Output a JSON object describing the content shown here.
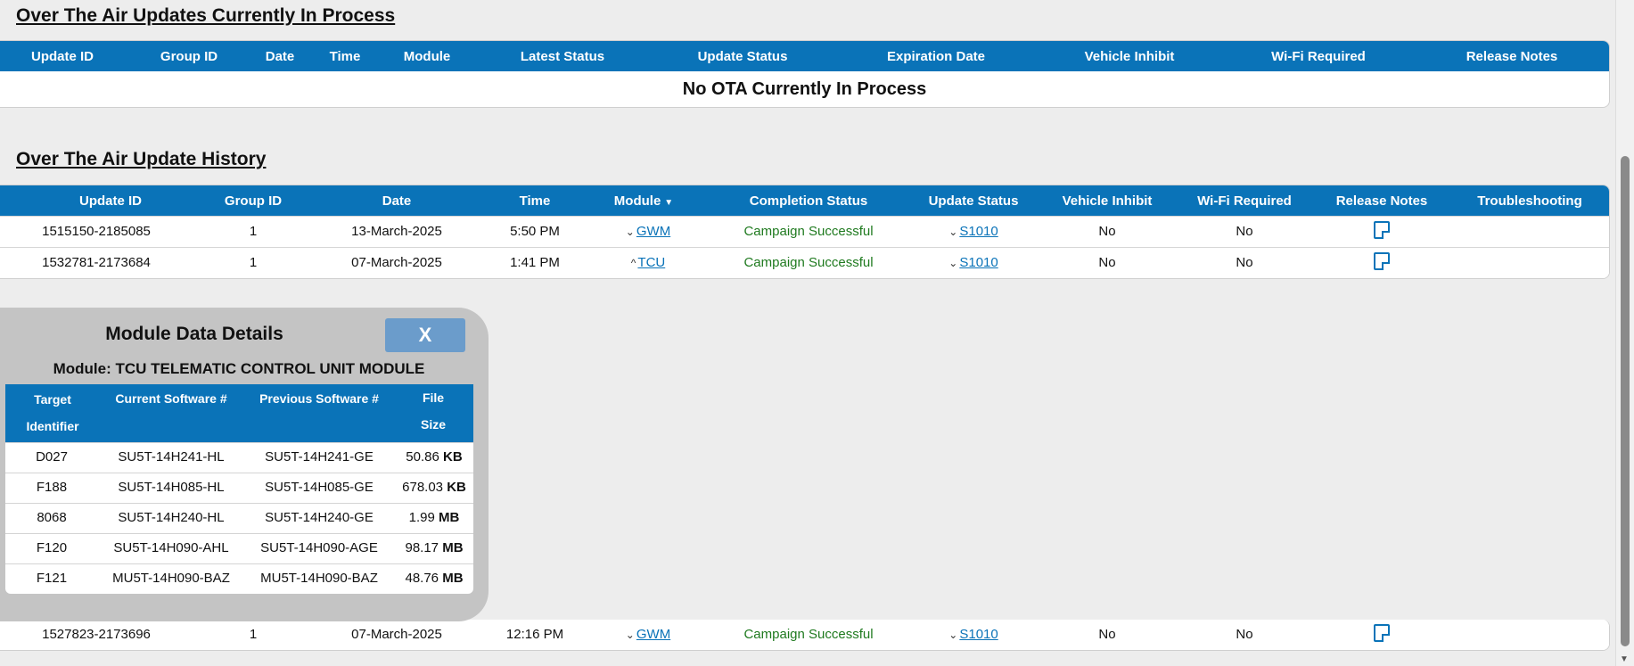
{
  "in_process": {
    "title": "Over The Air Updates Currently In Process",
    "headers": [
      "Update ID",
      "Group ID",
      "Date",
      "Time",
      "Module",
      "Latest Status",
      "Update Status",
      "Expiration Date",
      "Vehicle Inhibit",
      "Wi-Fi Required",
      "Release Notes"
    ],
    "empty_message": "No OTA Currently In Process"
  },
  "history": {
    "title": "Over The Air Update History",
    "headers": [
      "Update ID",
      "Group ID",
      "Date",
      "Time",
      "Module",
      "Completion Status",
      "Update Status",
      "Vehicle Inhibit",
      "Wi-Fi Required",
      "Release Notes",
      "Troubleshooting"
    ],
    "rows": [
      {
        "update_id": "1515150-2185085",
        "group_id": "1",
        "date": "13-March-2025",
        "time": "5:50 PM",
        "module_chevron": "⌄",
        "module": "GWM",
        "completion": "Campaign Successful",
        "status_chevron": "⌄",
        "update_status": "S1010",
        "vehicle_inhibit": "No",
        "wifi": "No"
      },
      {
        "update_id": "1532781-2173684",
        "group_id": "1",
        "date": "07-March-2025",
        "time": "1:41 PM",
        "module_chevron": "^",
        "module": "TCU",
        "completion": "Campaign Successful",
        "status_chevron": "⌄",
        "update_status": "S1010",
        "vehicle_inhibit": "No",
        "wifi": "No"
      },
      {
        "update_id": "1527823-2173696",
        "group_id": "1",
        "date": "07-March-2025",
        "time": "12:16 PM",
        "module_chevron": "⌄",
        "module": "GWM",
        "completion": "Campaign Successful",
        "status_chevron": "⌄",
        "update_status": "S1010",
        "vehicle_inhibit": "No",
        "wifi": "No"
      }
    ]
  },
  "modal": {
    "title": "Module Data Details",
    "close_label": "X",
    "subtitle": "Module: TCU TELEMATIC CONTROL UNIT MODULE",
    "headers": {
      "target_line1": "Target",
      "target_line2": "Identifier",
      "current": "Current Software #",
      "previous": "Previous Software #",
      "size": "File Size"
    },
    "rows": [
      {
        "target": "D027",
        "current": "SU5T-14H241-HL",
        "previous": "SU5T-14H241-GE",
        "size": "50.86",
        "unit": "KB"
      },
      {
        "target": "F188",
        "current": "SU5T-14H085-HL",
        "previous": "SU5T-14H085-GE",
        "size": "678.03",
        "unit": "KB"
      },
      {
        "target": "8068",
        "current": "SU5T-14H240-HL",
        "previous": "SU5T-14H240-GE",
        "size": "1.99",
        "unit": "MB"
      },
      {
        "target": "F120",
        "current": "SU5T-14H090-AHL",
        "previous": "SU5T-14H090-AGE",
        "size": "98.17",
        "unit": "MB"
      },
      {
        "target": "F121",
        "current": "MU5T-14H090-BAZ",
        "previous": "MU5T-14H090-BAZ",
        "size": "48.76",
        "unit": "MB"
      }
    ]
  },
  "colors": {
    "header_blue": "#0a73b8",
    "success_green": "#1f7a1f",
    "modal_grey": "#c4c4c4",
    "close_blue": "#6b9ccb"
  },
  "icons": {
    "release_notes": "note-icon",
    "sort": "sort-down-icon"
  }
}
